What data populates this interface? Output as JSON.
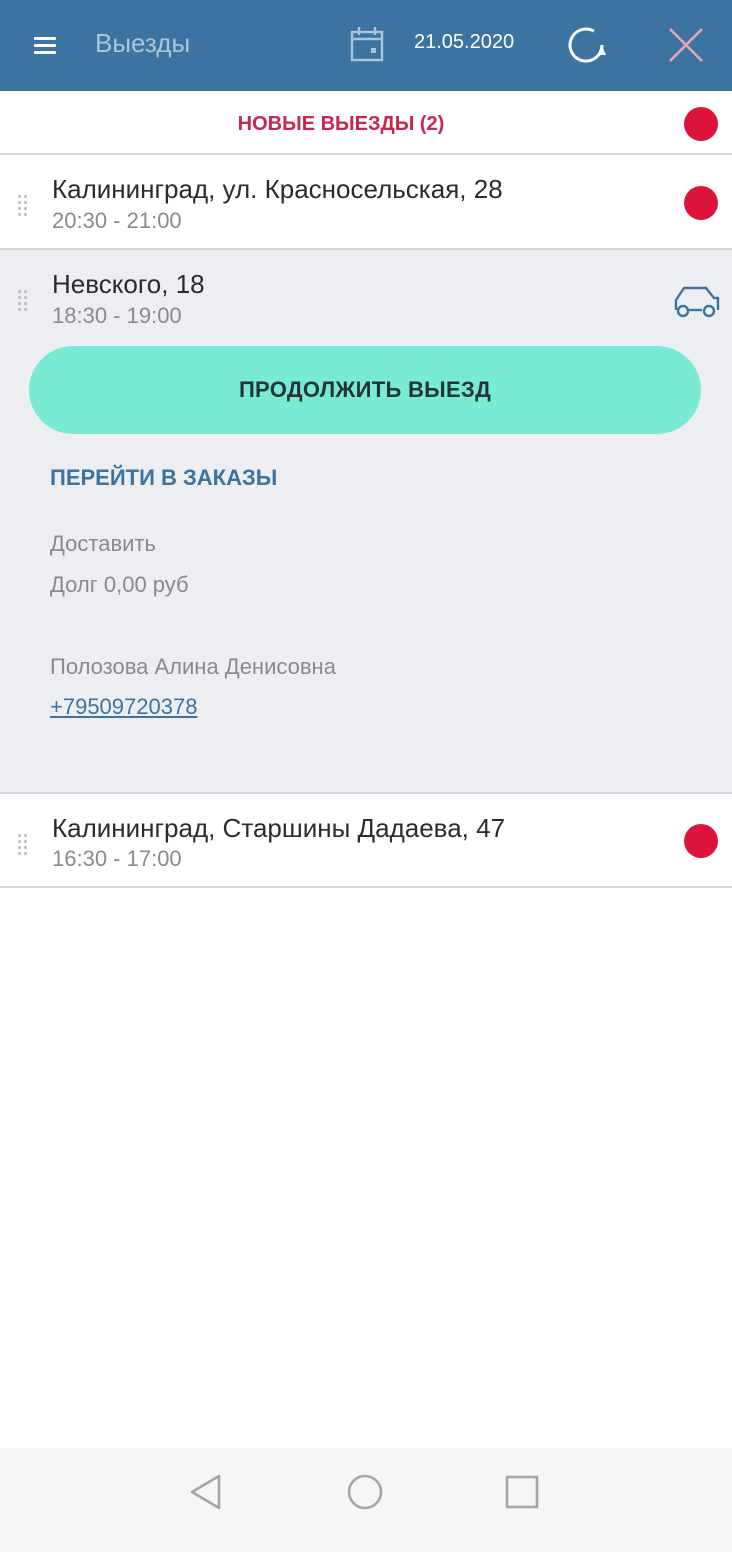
{
  "header": {
    "title": "Выезды",
    "date": "21.05.2020",
    "icons": {
      "menu": "hamburger-menu-icon",
      "calendar": "calendar-icon",
      "refresh": "refresh-icon",
      "close": "close-icon"
    }
  },
  "new_trips": {
    "label": "НОВЫЕ ВЫЕЗДЫ (2)",
    "status_color": "#dc143c"
  },
  "trips": [
    {
      "address": "Калининград, ул. Красносельская, 28",
      "time": "20:30 - 21:00",
      "status": "new",
      "status_icon": "red-dot-icon"
    },
    {
      "address": "Невского, 18",
      "time": "18:30 - 19:00",
      "status": "in-progress",
      "status_icon": "car-icon",
      "expanded": true,
      "continue_label": "ПРОДОЛЖИТЬ ВЫЕЗД",
      "orders_link": "ПЕРЕЙТИ В ЗАКАЗЫ",
      "action": "Доставить",
      "debt": "Долг 0,00 руб",
      "contact_name": "Полозова Алина Денисовна",
      "contact_phone": "+79509720378"
    },
    {
      "address": "Калининград, Старшины Дадаева, 47",
      "time": "16:30 - 17:00",
      "status": "new",
      "status_icon": "red-dot-icon"
    }
  ],
  "colors": {
    "header_bg": "#3d73a1",
    "accent_button": "#79ead3",
    "alert": "#dc143c",
    "link": "#3d73a1"
  },
  "system_nav": {
    "icons": [
      "back-triangle-icon",
      "home-circle-icon",
      "recents-square-icon"
    ]
  }
}
